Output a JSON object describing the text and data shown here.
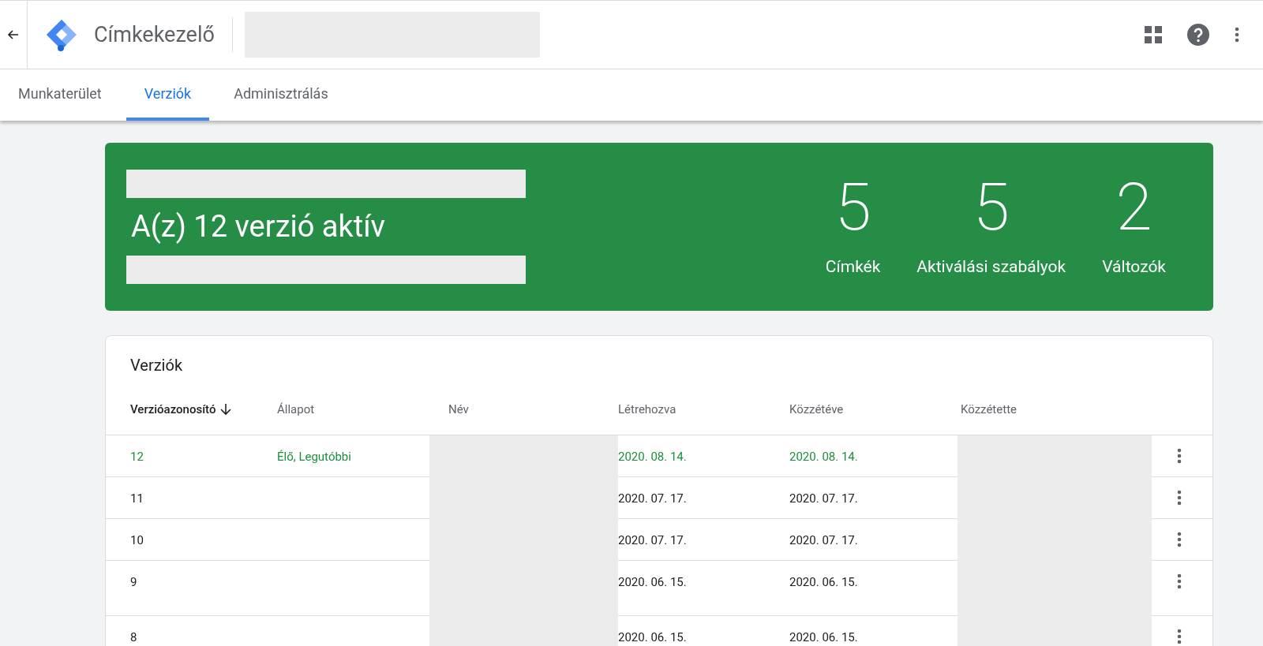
{
  "app": {
    "title": "Címkekezelő"
  },
  "tabs": [
    {
      "label": "Munkaterület",
      "selected": false
    },
    {
      "label": "Verziók",
      "selected": true
    },
    {
      "label": "Adminisztrálás",
      "selected": false
    }
  ],
  "banner": {
    "title": "A(z) 12 verzió aktív",
    "stats": [
      {
        "value": "5",
        "label": "Címkék"
      },
      {
        "value": "5",
        "label": "Aktiválási szabályok"
      },
      {
        "value": "2",
        "label": "Változók"
      }
    ]
  },
  "versions": {
    "title": "Verziók",
    "columns": [
      {
        "label": "Verzióazonosító",
        "sorted": true
      },
      {
        "label": "Állapot",
        "sorted": false
      },
      {
        "label": "Név",
        "sorted": false
      },
      {
        "label": "Létrehozva",
        "sorted": false
      },
      {
        "label": "Közzétéve",
        "sorted": false
      },
      {
        "label": "Közzétette",
        "sorted": false
      }
    ],
    "rows": [
      {
        "id": "12",
        "status": "Élő, Legutóbbi",
        "created": "2020. 08. 14.",
        "published": "2020. 08. 14.",
        "live": true
      },
      {
        "id": "11",
        "created": "2020. 07. 17.",
        "published": "2020. 07. 17.",
        "live": false
      },
      {
        "id": "10",
        "created": "2020. 07. 17.",
        "published": "2020. 07. 17.",
        "live": false
      },
      {
        "id": "9",
        "created": "2020. 06. 15.",
        "published": "2020. 06. 15.",
        "live": false
      },
      {
        "id": "8",
        "created": "2020. 06. 15.",
        "published": "2020. 06. 15.",
        "live": false
      }
    ]
  }
}
